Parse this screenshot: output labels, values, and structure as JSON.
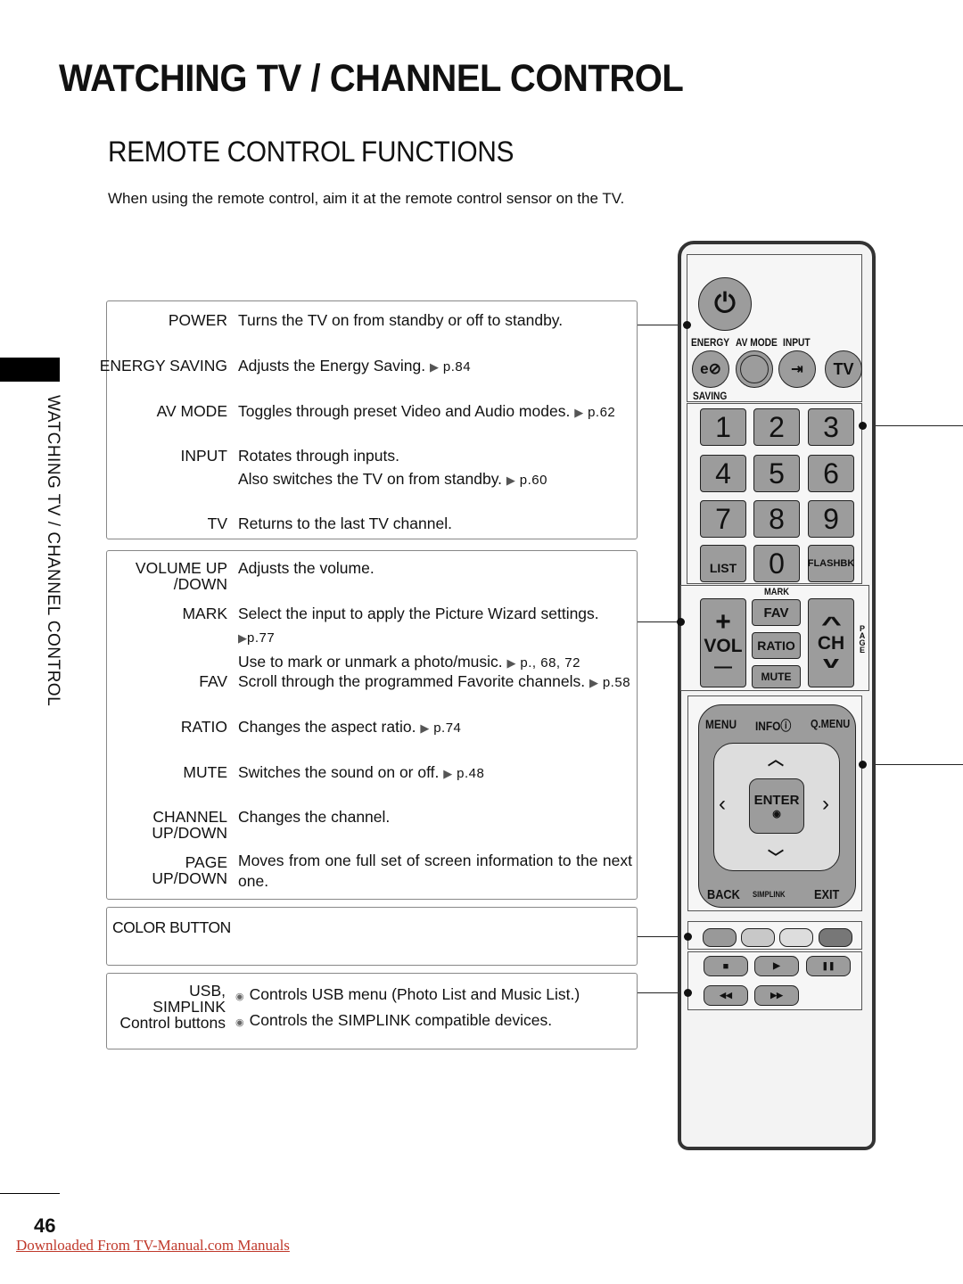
{
  "header": {
    "title": "WATCHING TV / CHANNEL CONTROL",
    "section_title": "REMOTE CONTROL FUNCTIONS",
    "intro": "When using the remote control, aim it at the remote control sensor on the TV."
  },
  "side_tab": "WATCHING TV / CHANNEL CONTROL",
  "box1": {
    "power": {
      "label": "POWER",
      "desc": "Turns the TV on from standby or off to standby."
    },
    "energy": {
      "label": "ENERGY SAVING",
      "desc": "Adjusts the Energy Saving.",
      "ref": "p.84"
    },
    "avmode": {
      "label": "AV MODE",
      "desc": "Toggles through preset Video and Audio modes.",
      "ref": "p.62"
    },
    "input": {
      "label": "INPUT",
      "desc": "Rotates through inputs.",
      "desc2": "Also switches the TV on from standby.",
      "ref": "p.60"
    },
    "tv": {
      "label": "TV",
      "desc": "Returns to the last TV channel."
    }
  },
  "box2": {
    "volume": {
      "label": "VOLUME UP",
      "label2": "/DOWN",
      "desc": "Adjusts the volume."
    },
    "mark": {
      "label": "MARK",
      "desc": "Select the input to apply the Picture Wizard settings.",
      "ref": "p.77",
      "desc2": "Use to mark or unmark a photo/music.",
      "ref2": "p., 68, 72"
    },
    "fav": {
      "label": "FAV",
      "desc": "Scroll through the programmed Favorite channels.",
      "ref": "p.58"
    },
    "ratio": {
      "label": "RATIO",
      "desc": "Changes the aspect ratio.",
      "ref": "p.74"
    },
    "mute": {
      "label": "MUTE",
      "desc": "Switches the sound on or off.",
      "ref": "p.48"
    },
    "channel": {
      "label": "CHANNEL",
      "label2": "UP/DOWN",
      "desc": "Changes the channel."
    },
    "page": {
      "label": "PAGE",
      "label2": "UP/DOWN",
      "desc": "Moves from one full set of screen information to the next one."
    }
  },
  "box3": {
    "label": "COLOR BUTTON"
  },
  "box4": {
    "label1": "USB,",
    "label2": "SIMPLINK",
    "label3": "Control buttons",
    "items": [
      "Controls USB menu (Photo List and Music List.)",
      "Controls the SIMPLINK compatible devices."
    ]
  },
  "remote": {
    "power": "⏻",
    "energy": "ENERGY",
    "avmode": "AV MODE",
    "input": "INPUT",
    "saving": "SAVING",
    "eco": "e⊘",
    "tv": "TV",
    "input_icon": "⇥",
    "numbers": [
      "1",
      "2",
      "3",
      "4",
      "5",
      "6",
      "7",
      "8",
      "9"
    ],
    "list": "LIST",
    "zero": "0",
    "flashbk": "FLASHBK",
    "mark": "MARK",
    "fav": "FAV",
    "ratio": "RATIO",
    "mute": "MUTE",
    "vol": "VOL",
    "ch": "CH",
    "plus": "+",
    "minus": "—",
    "up": "^",
    "down": "v",
    "page": "PAGE",
    "menu": "MENU",
    "info": "INFO",
    "qmenu": "Q.MENU",
    "enter": "ENTER",
    "back": "BACK",
    "simplink": "SIMPLINK",
    "exit": "EXIT",
    "stop": "■",
    "play": "▶",
    "pause": "❚❚",
    "rew": "◀◀",
    "ff": "▶▶"
  },
  "footer": {
    "page_number": "46",
    "download_link": "Downloaded From TV-Manual.com Manuals"
  }
}
